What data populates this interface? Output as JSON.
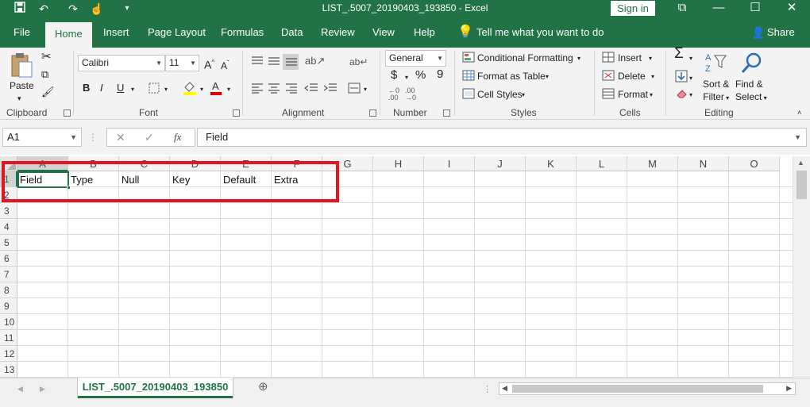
{
  "window": {
    "title": "LIST_.5007_20190403_193850  -  Excel",
    "sign_in": "Sign in",
    "buttons": {
      "restore": "⧉",
      "minimize": "—",
      "maximize": "☐",
      "close": "✕"
    }
  },
  "tabs": [
    "File",
    "Home",
    "Insert",
    "Page Layout",
    "Formulas",
    "Data",
    "Review",
    "View",
    "Help"
  ],
  "tell_me": "Tell me what you want to do",
  "share": "Share",
  "ribbon": {
    "clipboard": {
      "paste": "Paste",
      "label": "Clipboard"
    },
    "font": {
      "name": "Calibri",
      "size": "11",
      "label": "Font"
    },
    "alignment": {
      "label": "Alignment"
    },
    "number": {
      "format": "General",
      "label": "Number",
      "currency": "$",
      "percent": "%",
      "comma": "9"
    },
    "styles": {
      "conditional": "Conditional Formatting",
      "format_table": "Format as Table",
      "cell_styles": "Cell Styles",
      "label": "Styles"
    },
    "cells": {
      "insert": "Insert",
      "delete": "Delete",
      "format": "Format",
      "label": "Cells"
    },
    "editing": {
      "sort_filter_1": "Sort &",
      "sort_filter_2": "Filter",
      "find_select_1": "Find &",
      "find_select_2": "Select",
      "label": "Editing"
    }
  },
  "formula_bar": {
    "name_box": "A1",
    "fx": "fx",
    "content": "Field"
  },
  "sheet": {
    "columns": [
      "A",
      "B",
      "C",
      "D",
      "E",
      "F",
      "G",
      "H",
      "I",
      "J",
      "K",
      "L",
      "M",
      "N",
      "O"
    ],
    "rows": [
      "1",
      "2",
      "3",
      "4",
      "5",
      "6",
      "7",
      "8",
      "9",
      "10",
      "11",
      "12",
      "13"
    ],
    "row1": [
      "Field",
      "Type",
      "Null",
      "Key",
      "Default",
      "Extra"
    ],
    "active_cell": "A1"
  },
  "sheet_tab": "LIST_.5007_20190403_193850",
  "colors": {
    "accent": "#217346",
    "highlight_box": "#e3151f"
  }
}
